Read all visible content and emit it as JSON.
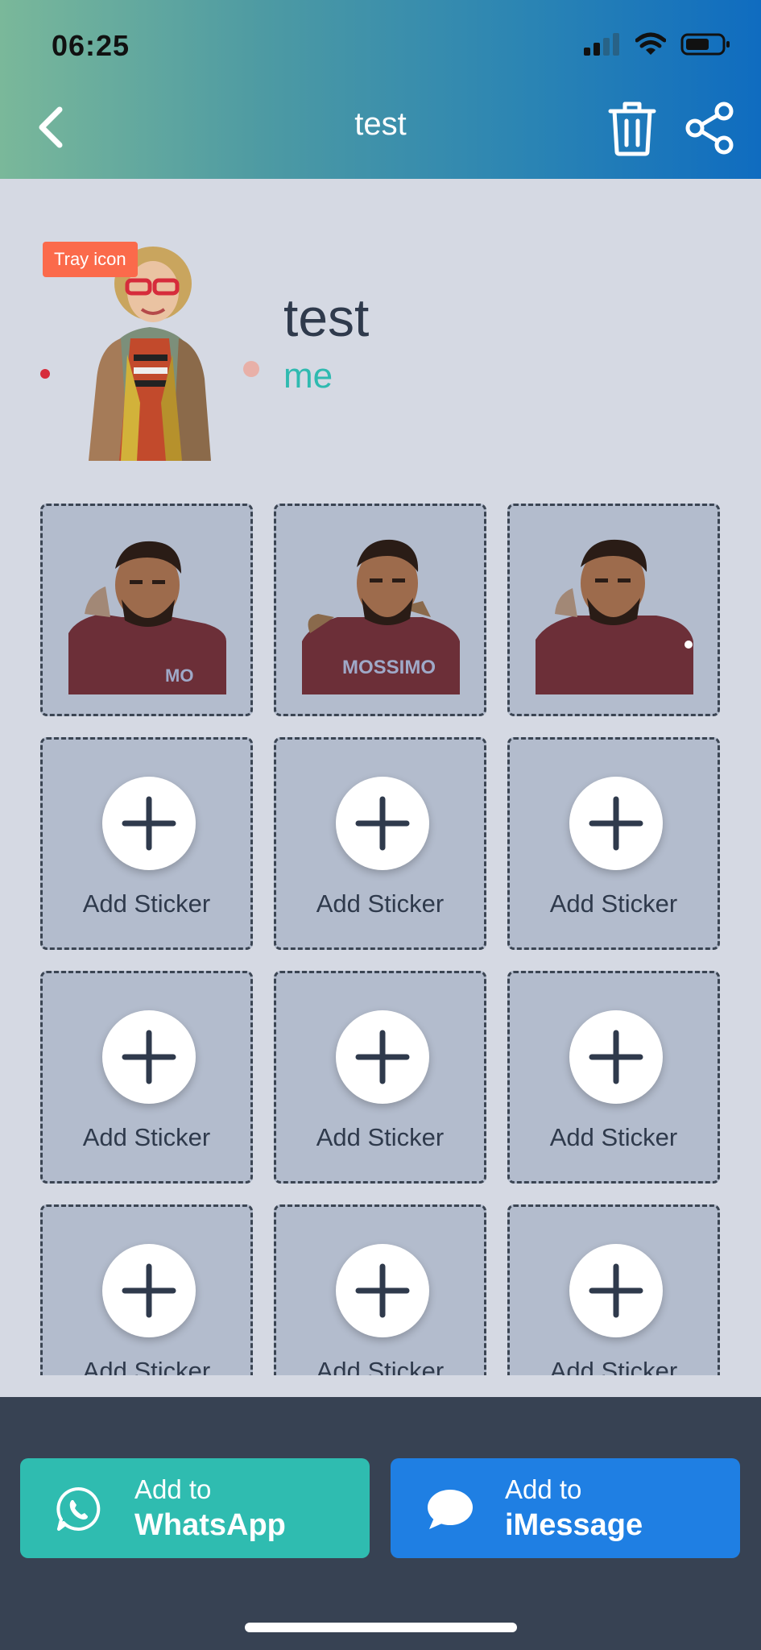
{
  "status_bar": {
    "time": "06:25"
  },
  "nav": {
    "title": "test"
  },
  "pack": {
    "tray_badge": "Tray icon",
    "name": "test",
    "author": "me"
  },
  "stickers": [
    {
      "filled": true
    },
    {
      "filled": true
    },
    {
      "filled": true
    },
    {
      "filled": false,
      "label": "Add Sticker"
    },
    {
      "filled": false,
      "label": "Add Sticker"
    },
    {
      "filled": false,
      "label": "Add Sticker"
    },
    {
      "filled": false,
      "label": "Add Sticker"
    },
    {
      "filled": false,
      "label": "Add Sticker"
    },
    {
      "filled": false,
      "label": "Add Sticker"
    },
    {
      "filled": false,
      "label": "Add Sticker"
    },
    {
      "filled": false,
      "label": "Add Sticker"
    },
    {
      "filled": false,
      "label": "Add Sticker"
    }
  ],
  "footer": {
    "whatsapp": {
      "line1": "Add to",
      "line2": "WhatsApp"
    },
    "imessage": {
      "line1": "Add to",
      "line2": "iMessage"
    }
  },
  "colors": {
    "accent_teal": "#2fbcb0",
    "accent_blue": "#1f7fe3",
    "badge": "#fb6a4b",
    "footer_bg": "#374253"
  }
}
